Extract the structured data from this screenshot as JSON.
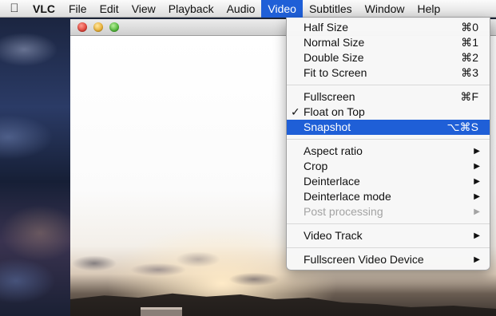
{
  "menubar": {
    "apple_icon": "apple-icon",
    "app_name": "VLC",
    "items": [
      "File",
      "Edit",
      "View",
      "Playback",
      "Audio",
      "Video",
      "Subtitles",
      "Window",
      "Help"
    ],
    "active": "Video"
  },
  "window": {
    "controls": [
      "close-button",
      "minimize-button",
      "zoom-button"
    ]
  },
  "video_menu": {
    "sections": [
      [
        {
          "label": "Half Size",
          "shortcut": "⌘0"
        },
        {
          "label": "Normal Size",
          "shortcut": "⌘1"
        },
        {
          "label": "Double Size",
          "shortcut": "⌘2"
        },
        {
          "label": "Fit to Screen",
          "shortcut": "⌘3"
        }
      ],
      [
        {
          "label": "Fullscreen",
          "shortcut": "⌘F"
        },
        {
          "label": "Float on Top",
          "checked": true
        },
        {
          "label": "Snapshot",
          "shortcut": "⌥⌘S",
          "highlighted": true
        }
      ],
      [
        {
          "label": "Aspect ratio",
          "submenu": true
        },
        {
          "label": "Crop",
          "submenu": true
        },
        {
          "label": "Deinterlace",
          "submenu": true
        },
        {
          "label": "Deinterlace mode",
          "submenu": true
        },
        {
          "label": "Post processing",
          "submenu": true,
          "disabled": true
        }
      ],
      [
        {
          "label": "Video Track",
          "submenu": true
        }
      ],
      [
        {
          "label": "Fullscreen Video Device",
          "submenu": true
        }
      ]
    ],
    "check_glyph": "✓",
    "submenu_glyph": "▶"
  },
  "colors": {
    "highlight": "#1f5fd7",
    "disabled_text": "#a3a3a3"
  }
}
